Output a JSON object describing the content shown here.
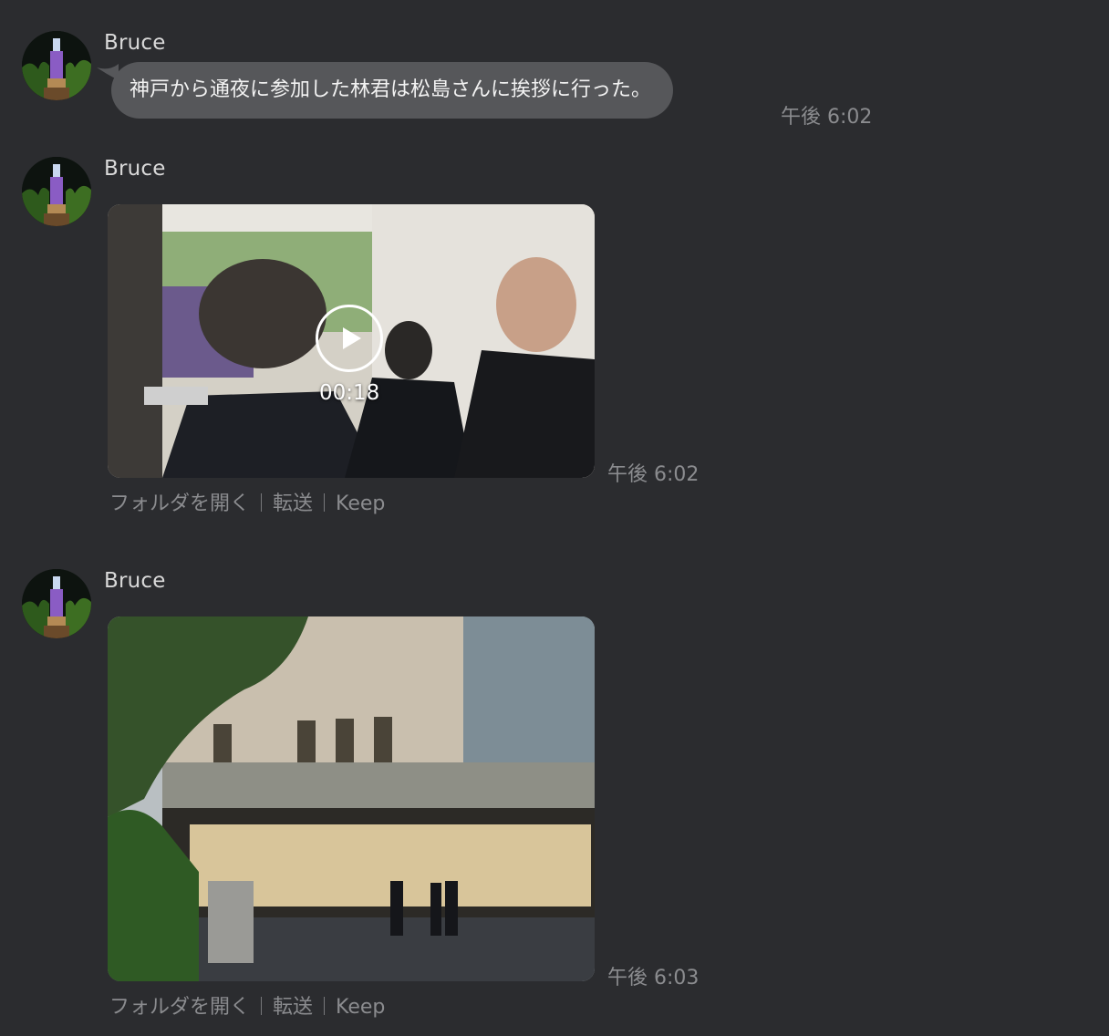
{
  "messages": [
    {
      "sender": "Bruce",
      "type": "text",
      "text": "神戸から通夜に参加した林君は松島さんに挨拶に行った。",
      "time": "午後 6:02"
    },
    {
      "sender": "Bruce",
      "type": "video",
      "duration": "00:18",
      "time": "午後 6:02",
      "actions": [
        "フォルダを開く",
        "転送",
        "Keep"
      ]
    },
    {
      "sender": "Bruce",
      "type": "photo",
      "time": "午後 6:03",
      "actions": [
        "フォルダを開く",
        "転送",
        "Keep"
      ]
    }
  ],
  "colors": {
    "background": "#2b2c2f",
    "bubble": "#56575a",
    "meta_text": "#8b8c8f"
  }
}
